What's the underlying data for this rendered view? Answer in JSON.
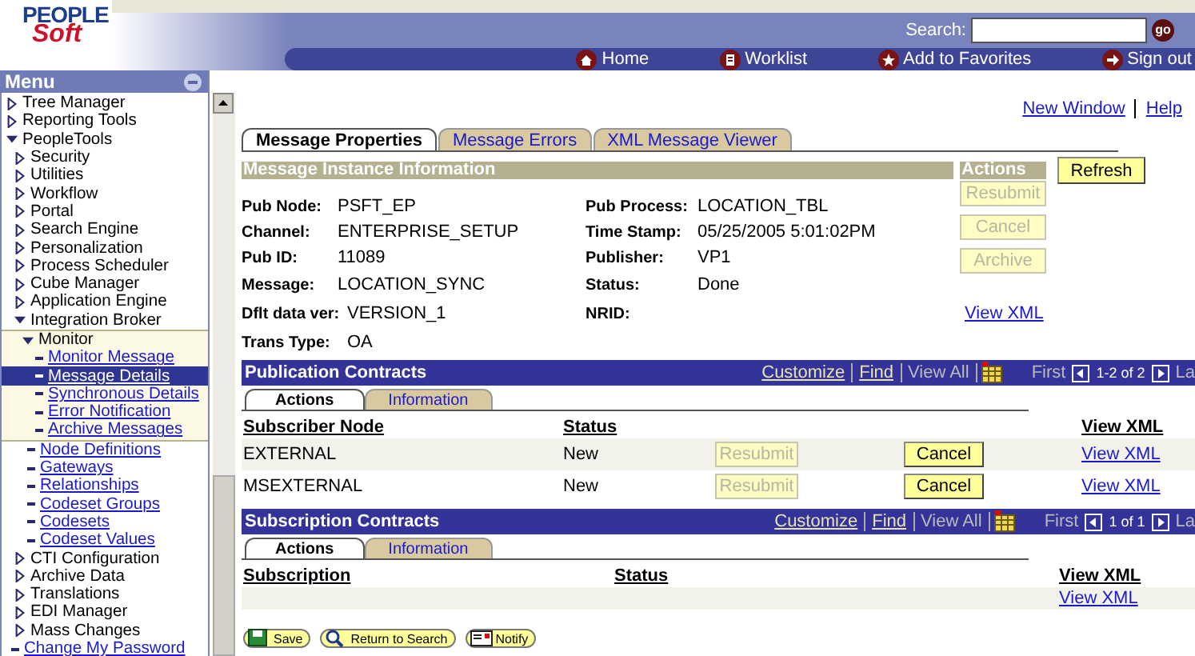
{
  "header": {
    "logo_top": "PEOPLE",
    "logo_bottom": "Soft",
    "search_label": "Search:",
    "search_button": "go",
    "nav": [
      {
        "label": "Home"
      },
      {
        "label": "Worklist"
      },
      {
        "label": "Add to Favorites"
      },
      {
        "label": "Sign out"
      }
    ]
  },
  "menu": {
    "title": "Menu",
    "items": [
      {
        "label": "Tree Manager",
        "kind": "folder",
        "expanded": false,
        "selected": false
      },
      {
        "label": "Reporting Tools",
        "kind": "folder",
        "expanded": false,
        "selected": false
      },
      {
        "label": "PeopleTools",
        "kind": "folder",
        "expanded": true,
        "selected": false,
        "children": [
          {
            "label": "Security",
            "kind": "folder",
            "expanded": false,
            "selected": false
          },
          {
            "label": "Utilities",
            "kind": "folder",
            "expanded": false,
            "selected": false
          },
          {
            "label": "Workflow",
            "kind": "folder",
            "expanded": false,
            "selected": false
          },
          {
            "label": "Portal",
            "kind": "folder",
            "expanded": false,
            "selected": false
          },
          {
            "label": "Search Engine",
            "kind": "folder",
            "expanded": false,
            "selected": false
          },
          {
            "label": "Personalization",
            "kind": "folder",
            "expanded": false,
            "selected": false
          },
          {
            "label": "Process Scheduler",
            "kind": "folder",
            "expanded": false,
            "selected": false
          },
          {
            "label": "Cube Manager",
            "kind": "folder",
            "expanded": false,
            "selected": false
          },
          {
            "label": "Application Engine",
            "kind": "folder",
            "expanded": false,
            "selected": false
          },
          {
            "label": "Integration Broker",
            "kind": "folder",
            "expanded": true,
            "selected": false,
            "children": [
              {
                "label": "Monitor",
                "kind": "folder",
                "expanded": true,
                "selected": false,
                "children": [
                  {
                    "label": "Monitor Message",
                    "kind": "link",
                    "selected": false
                  },
                  {
                    "label": "Message Details",
                    "kind": "link",
                    "selected": true
                  },
                  {
                    "label": "Synchronous Details",
                    "kind": "link",
                    "selected": false
                  },
                  {
                    "label": "Error Notification",
                    "kind": "link",
                    "selected": false
                  },
                  {
                    "label": "Archive Messages",
                    "kind": "link",
                    "selected": false
                  }
                ]
              },
              {
                "label": "Node Definitions",
                "kind": "link",
                "selected": false
              },
              {
                "label": "Gateways",
                "kind": "link",
                "selected": false
              },
              {
                "label": "Relationships",
                "kind": "link",
                "selected": false
              },
              {
                "label": "Codeset Groups",
                "kind": "link",
                "selected": false
              },
              {
                "label": "Codesets",
                "kind": "link",
                "selected": false
              },
              {
                "label": "Codeset Values",
                "kind": "link",
                "selected": false
              }
            ]
          },
          {
            "label": "CTI Configuration",
            "kind": "folder",
            "expanded": false,
            "selected": false
          },
          {
            "label": "Archive Data",
            "kind": "folder",
            "expanded": false,
            "selected": false
          },
          {
            "label": "Translations",
            "kind": "folder",
            "expanded": false,
            "selected": false
          },
          {
            "label": "EDI Manager",
            "kind": "folder",
            "expanded": false,
            "selected": false
          },
          {
            "label": "Mass Changes",
            "kind": "folder",
            "expanded": false,
            "selected": false
          }
        ]
      },
      {
        "label": "Change My Password",
        "kind": "link",
        "selected": false
      }
    ]
  },
  "top_links": [
    "New Window",
    "Help"
  ],
  "tabs": [
    {
      "label": "Message Properties",
      "selected": true
    },
    {
      "label": "Message Errors",
      "selected": false
    },
    {
      "label": "XML Message Viewer",
      "selected": false
    }
  ],
  "message_instance": {
    "title": "Message Instance Information",
    "fields_left": [
      {
        "label": "Pub Node:",
        "value": "PSFT_EP"
      },
      {
        "label": "Channel:",
        "value": "ENTERPRISE_SETUP"
      },
      {
        "label": "Pub ID:",
        "value": "11089"
      },
      {
        "label": "Message:",
        "value": "LOCATION_SYNC"
      },
      {
        "label": "Dflt data ver:",
        "value": "VERSION_1"
      },
      {
        "label": "Trans Type:",
        "value": "OA"
      }
    ],
    "fields_right": [
      {
        "label": "Pub Process:",
        "value": "LOCATION_TBL"
      },
      {
        "label": "Time Stamp:",
        "value": "05/25/2005 5:01:02PM"
      },
      {
        "label": "Publisher:",
        "value": "VP1"
      },
      {
        "label": "Status:",
        "value": "Done"
      },
      {
        "label": "NRID:"
      }
    ]
  },
  "actions": {
    "title": "Actions",
    "buttons": [
      {
        "label": "Resubmit",
        "disabled": true
      },
      {
        "label": "Cancel",
        "disabled": true
      },
      {
        "label": "Archive",
        "disabled": true
      }
    ],
    "link": "View XML"
  },
  "refresh": {
    "label": "Refresh"
  },
  "grids": [
    {
      "title": "Publication Contracts",
      "tools": [
        "Customize",
        "Find"
      ],
      "view_all": "View All",
      "first": "First",
      "range": "1-2 of 2",
      "last": "La",
      "tabs": [
        {
          "label": "Actions",
          "selected": true
        },
        {
          "label": "Information",
          "selected": false
        }
      ],
      "columns": [
        "Subscriber Node",
        "Status",
        "View XML"
      ],
      "rows": [
        {
          "node": "EXTERNAL",
          "status": "New",
          "resubmit": {
            "label": "Resubmit",
            "disabled": true
          },
          "cancel": {
            "label": "Cancel",
            "disabled": false
          },
          "link": "View XML"
        },
        {
          "node": "MSEXTERNAL",
          "status": "New",
          "resubmit": {
            "label": "Resubmit",
            "disabled": true
          },
          "cancel": {
            "label": "Cancel",
            "disabled": false
          },
          "link": "View XML"
        }
      ]
    },
    {
      "title": "Subscription Contracts",
      "tools": [
        "Customize",
        "Find"
      ],
      "view_all": "View All",
      "first": "First",
      "range": "1 of 1",
      "last": "La",
      "tabs": [
        {
          "label": "Actions",
          "selected": true
        },
        {
          "label": "Information",
          "selected": false
        }
      ],
      "columns": [
        "Subscription",
        "Status",
        "View XML"
      ],
      "rows": [
        {
          "link": "View XML"
        }
      ]
    }
  ],
  "footer_buttons": [
    {
      "label": "Save"
    },
    {
      "label": "Return to Search"
    },
    {
      "label": "Notify"
    }
  ]
}
